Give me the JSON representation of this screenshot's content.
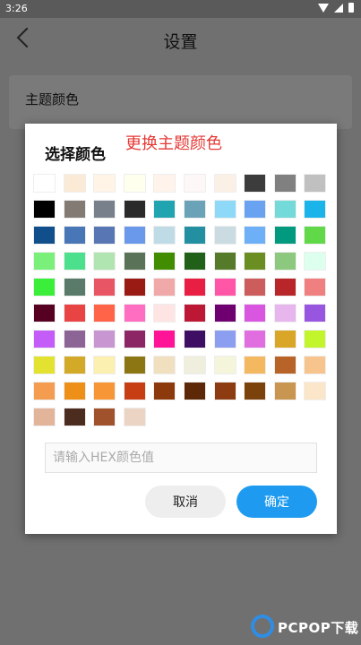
{
  "status": {
    "time": "3:26"
  },
  "appbar": {
    "title": "设置"
  },
  "card1": {
    "label": "主题颜色"
  },
  "dialog": {
    "title": "选择颜色",
    "annotation": "更换主题颜色",
    "hex_placeholder": "请输入HEX颜色值",
    "cancel_label": "取消",
    "ok_label": "确定"
  },
  "swatches": [
    "#FFFFFF",
    "#FBEAD6",
    "#FFF4E6",
    "#FFFFEE",
    "#FFF3EC",
    "#FDF7F7",
    "#FBF0E6",
    "#3C3C3C",
    "#808080",
    "#C0C0C0",
    "#000000",
    "#847A74",
    "#77808B",
    "#2A2A2A",
    "#20A4B0",
    "#6AA2B8",
    "#8ED8F8",
    "#6AA2F2",
    "#73D9D9",
    "#1AB4EA",
    "#104E8C",
    "#4876B6",
    "#5876B4",
    "#6A98EA",
    "#BFDCE6",
    "#2290A0",
    "#CADBE2",
    "#6EB0F8",
    "#029A7E",
    "#60D848",
    "#7AF07A",
    "#4CE08C",
    "#B0E4B0",
    "#5A7258",
    "#428C00",
    "#216018",
    "#557A2A",
    "#6B8E23",
    "#8CC97E",
    "#DDFFEE",
    "#3AEE3A",
    "#5A7A6A",
    "#E85666",
    "#9A1A14",
    "#F0A8A8",
    "#E81E42",
    "#FF56A8",
    "#CD5C5C",
    "#B8262A",
    "#F08080",
    "#560022",
    "#E94444",
    "#FF6448",
    "#FF6EC0",
    "#FFE4E4",
    "#BC1836",
    "#6E0070",
    "#D856E0",
    "#E6B6EC",
    "#9856E0",
    "#C45CF8",
    "#8C6496",
    "#C896D0",
    "#8C2664",
    "#FF1498",
    "#3E0E64",
    "#8C9EF0",
    "#E06EE0",
    "#DAA628",
    "#C2F52C",
    "#E4E230",
    "#D2AA28",
    "#FBF0B0",
    "#8C7614",
    "#F0E0C0",
    "#F0EEDC",
    "#F5F5DC",
    "#F4B860",
    "#B86428",
    "#F6C48C",
    "#F49C50",
    "#EE9018",
    "#F69636",
    "#C83E14",
    "#8C3A0C",
    "#5C2808",
    "#8C3C10",
    "#7C420C",
    "#C89650",
    "#FCE6CA",
    "#E2B49A",
    "#4C2C1E",
    "#A0522D",
    "#ECD4C4"
  ],
  "watermark": {
    "text": "PCPOP下载"
  }
}
